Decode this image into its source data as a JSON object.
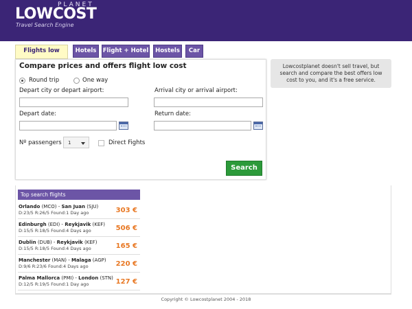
{
  "header": {
    "logo_top": "PLANET",
    "logo_main": "LOWCOST",
    "tagline": "Travel Search Engine",
    "bg_color": "#3b2576"
  },
  "tabs": [
    {
      "label": "Flights low cost",
      "active": true
    },
    {
      "label": "Hotels",
      "active": false
    },
    {
      "label": "Flight + Hotel",
      "active": false
    },
    {
      "label": "Hostels",
      "active": false
    },
    {
      "label": "Car",
      "active": false
    }
  ],
  "form": {
    "title": "Compare prices and offers flight low cost",
    "trip_round": "Round trip",
    "trip_oneway": "One way",
    "trip_selected": "Round trip",
    "depart_city_label": "Depart city or depart airport:",
    "arrival_city_label": "Arrival city or arrival airport:",
    "depart_date_label": "Depart date:",
    "return_date_label": "Return date:",
    "passengers_label": "Nº passengers",
    "passengers_value": "1",
    "direct_label": "Direct Fights",
    "search_button": "Search"
  },
  "info_box": "Lowcostplanet doesn't sell travel, but search and compare the best offers low cost to you, and it's a free service.",
  "top_search": {
    "title": "Top search flights",
    "items": [
      {
        "from": "Orlando",
        "from_code": "(MCO)",
        "to": "San Juan",
        "to_code": "(SJU)",
        "d_label": "D:",
        "d_val": "23/5",
        "r_label": "R:",
        "r_val": "26/5",
        "found": "Found:1 Day ago",
        "price": "303 €"
      },
      {
        "from": "Edinburgh",
        "from_code": "(EDI)",
        "to": "Reykjavik",
        "to_code": "(KEF)",
        "d_label": "D:",
        "d_val": "15/5",
        "r_label": "R:",
        "r_val": "18/5",
        "found": "Found:4 Days ago",
        "price": "506 €"
      },
      {
        "from": "Dublin",
        "from_code": "(DUB)",
        "to": "Reykjavik",
        "to_code": "(KEF)",
        "d_label": "D:",
        "d_val": "15/5",
        "r_label": "R:",
        "r_val": "18/5",
        "found": "Found:4 Days ago",
        "price": "165 €"
      },
      {
        "from": "Manchester",
        "from_code": "(MAN)",
        "to": "Malaga",
        "to_code": "(AGP)",
        "d_label": "D:",
        "d_val": "9/6",
        "r_label": "R:",
        "r_val": "23/6",
        "found": "Found:4 Days ago",
        "price": "220 €"
      },
      {
        "from": "Palma Mallorca",
        "from_code": "(PMI)",
        "to": "London",
        "to_code": "(STN)",
        "d_label": "D:",
        "d_val": "12/5",
        "r_label": "R:",
        "r_val": "19/5",
        "found": "Found:1 Day ago",
        "price": "127 €"
      }
    ]
  },
  "footer": "Copyright © Lowcostplanet 2004 - 2018"
}
